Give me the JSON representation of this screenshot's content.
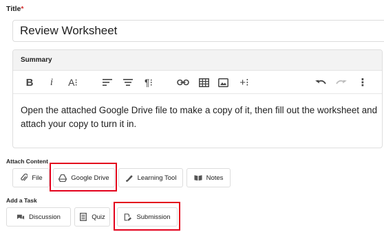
{
  "title_field": {
    "label": "Title",
    "required_mark": "*",
    "value": "Review Worksheet"
  },
  "summary": {
    "header": "Summary",
    "toolbar": {
      "bold": "B",
      "italic": "i",
      "font_size": "A⁝",
      "paragraph": "¶⁝",
      "insert_more": "+⁝",
      "more": "⋮"
    },
    "body": "Open the attached Google Drive file to make a copy of it, then fill out the worksheet and attach your copy to turn it in."
  },
  "attach_content": {
    "label": "Attach Content",
    "buttons": [
      {
        "label": "File"
      },
      {
        "label": "Google Drive"
      },
      {
        "label": "Learning Tool"
      },
      {
        "label": "Notes"
      }
    ]
  },
  "add_task": {
    "label": "Add a Task",
    "buttons": [
      {
        "label": "Discussion"
      },
      {
        "label": "Quiz"
      },
      {
        "label": "Submission"
      }
    ]
  },
  "colors": {
    "highlight": "#e3001b",
    "required": "#d32f2f"
  }
}
